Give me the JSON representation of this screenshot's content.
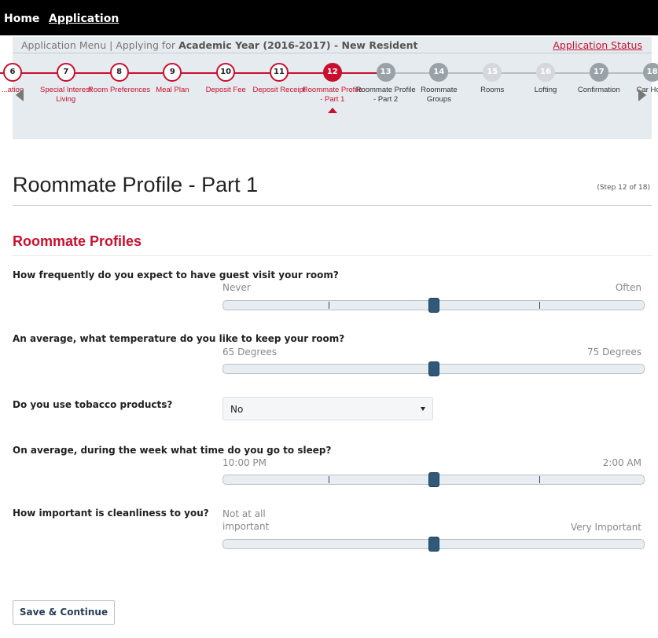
{
  "topnav": {
    "home": "Home",
    "application": "Application"
  },
  "appbar": {
    "menu_prefix": "Application Menu | Applying for",
    "academic_year": "Academic Year (2016-2017) - New Resident",
    "status_link": "Application Status"
  },
  "steps": [
    {
      "num": "6",
      "label": "...ation",
      "state": "done"
    },
    {
      "num": "7",
      "label": "Special Interest Living",
      "state": "done"
    },
    {
      "num": "8",
      "label": "Room Preferences",
      "state": "done"
    },
    {
      "num": "9",
      "label": "Meal Plan",
      "state": "done"
    },
    {
      "num": "10",
      "label": "Deposit Fee",
      "state": "done"
    },
    {
      "num": "11",
      "label": "Deposit Receipt",
      "state": "done"
    },
    {
      "num": "12",
      "label": "Roommate Profile - Part 1",
      "state": "active"
    },
    {
      "num": "13",
      "label": "Roommate Profile - Part 2",
      "state": "future"
    },
    {
      "num": "14",
      "label": "Roommate Groups",
      "state": "future"
    },
    {
      "num": "15",
      "label": "Rooms",
      "state": "faint"
    },
    {
      "num": "16",
      "label": "Lofting",
      "state": "faint"
    },
    {
      "num": "17",
      "label": "Confirmation",
      "state": "future"
    },
    {
      "num": "18",
      "label": "Car Hous",
      "state": "future"
    }
  ],
  "page": {
    "title": "Roommate Profile - Part 1",
    "step_indicator": "(Step 12 of 18)",
    "section_title": "Roommate Profiles"
  },
  "questions": {
    "guests": {
      "text": "How frequently do you expect to have guest visit your room?",
      "min": "Never",
      "max": "Often",
      "value": 0.5
    },
    "temperature": {
      "text": "An average, what temperature do you like to keep your room?",
      "min": "65 Degrees",
      "max": "75 Degrees",
      "value": 0.5
    },
    "tobacco": {
      "text": "Do you use tobacco products?",
      "selected": "No"
    },
    "sleep": {
      "text": "On average, during the week what time do you go to sleep?",
      "min": "10:00 PM",
      "max": "2:00 AM",
      "value": 0.5
    },
    "cleanliness": {
      "text": "How important is cleanliness to you?",
      "min": "Not at all important",
      "max": "Very Important",
      "value": 0.5
    }
  },
  "buttons": {
    "save_continue": "Save & Continue"
  },
  "colors": {
    "accent": "#c8102e",
    "topbar": "#000000",
    "handle": "#2f5a7c"
  }
}
